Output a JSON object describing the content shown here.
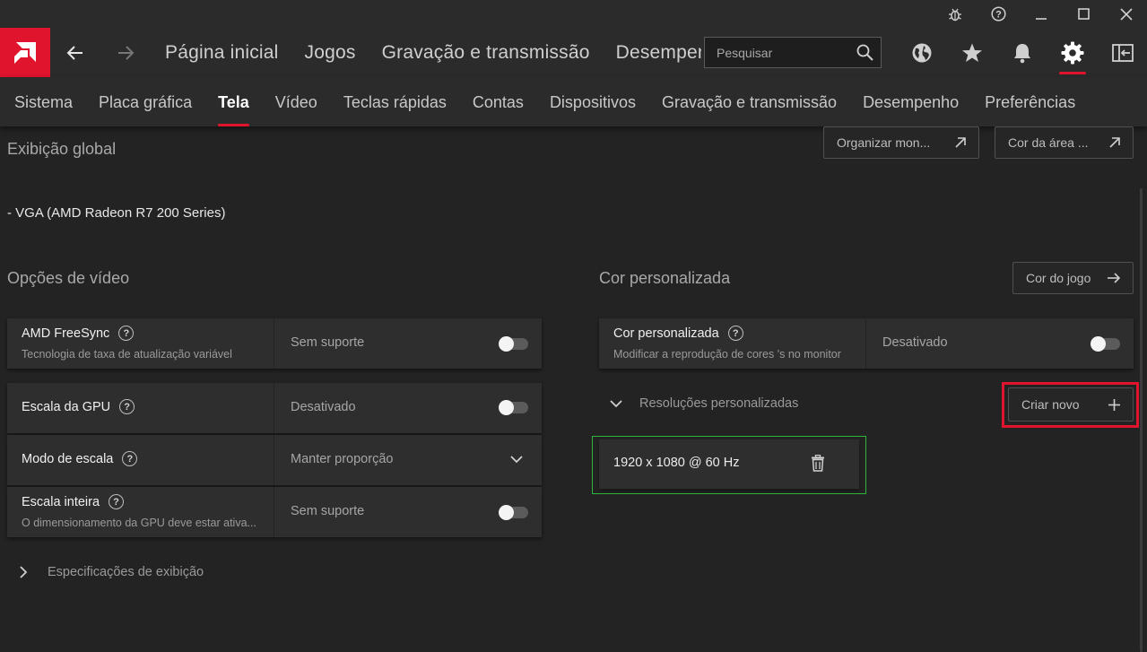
{
  "titlebar": {
    "icons": [
      "bug-icon",
      "help-icon",
      "minimize-icon",
      "maximize-icon",
      "close-icon"
    ]
  },
  "mainnav": {
    "logo": "amd-logo",
    "links": [
      "Página inicial",
      "Jogos",
      "Gravação e transmissão",
      "Desempenho"
    ],
    "search_placeholder": "Pesquisar",
    "icons": [
      "globe-icon",
      "star-icon",
      "bell-icon",
      "gear-icon",
      "sidebar-toggle-icon"
    ],
    "active_icon": "gear-icon"
  },
  "subnav": {
    "tabs": [
      "Sistema",
      "Placa gráfica",
      "Tela",
      "Vídeo",
      "Teclas rápidas",
      "Contas",
      "Dispositivos",
      "Gravação e transmissão",
      "Desempenho",
      "Preferências"
    ],
    "active": "Tela"
  },
  "global": {
    "title": "Exibição global",
    "organize_btn": "Organizar mon...",
    "desktop_color_btn": "Cor da área ...",
    "display_name": "- VGA (AMD Radeon R7 200 Series)"
  },
  "video_options": {
    "title": "Opções de vídeo",
    "freesync": {
      "name": "AMD FreeSync",
      "desc": "Tecnologia de taxa de atualização variável",
      "value": "Sem suporte"
    },
    "gpu_scaling": {
      "name": "Escala da GPU",
      "value": "Desativado"
    },
    "scaling_mode": {
      "name": "Modo de escala",
      "value": "Manter proporção"
    },
    "integer_scaling": {
      "name": "Escala inteira",
      "desc": "O dimensionamento da GPU deve estar ativa...",
      "value": "Sem suporte"
    },
    "display_specs": "Especificações de exibição"
  },
  "custom_color": {
    "title": "Cor personalizada",
    "game_color_btn": "Cor do jogo",
    "setting": {
      "name": "Cor personalizada",
      "desc": "Modificar a reprodução de cores 's no monitor",
      "value": "Desativado"
    },
    "custom_resolutions": "Resoluções personalizadas",
    "create_new_btn": "Criar novo",
    "resolutions": [
      "1920 x 1080 @ 60 Hz"
    ]
  },
  "colors": {
    "accent": "#e0142c",
    "highlight_green": "#2fb53a",
    "background": "#232323"
  }
}
